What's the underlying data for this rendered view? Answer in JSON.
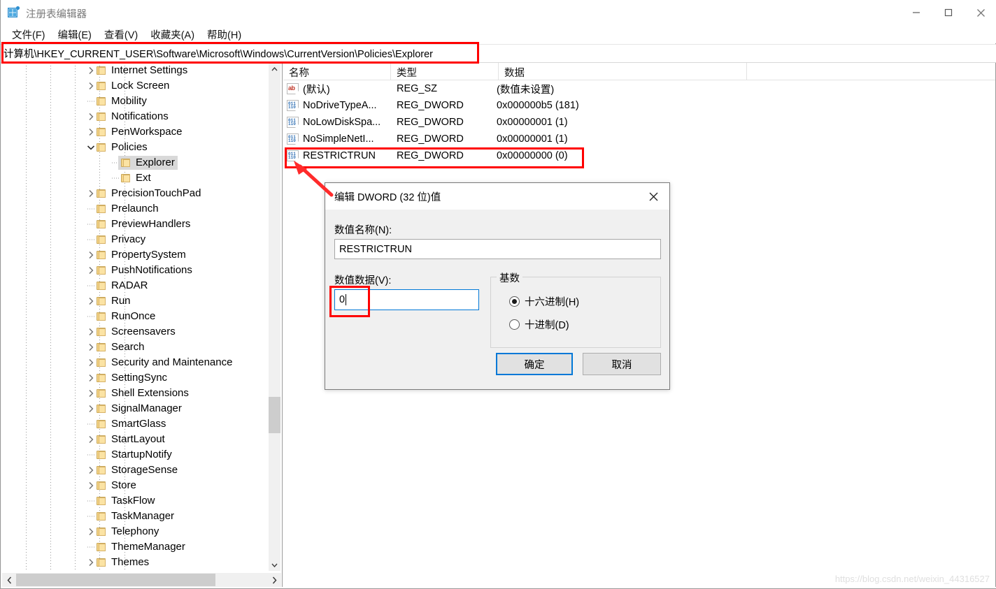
{
  "window": {
    "title": "注册表编辑器",
    "icon": "registry-editor-icon",
    "controls": {
      "minimize": "最小化",
      "maximize": "最大化",
      "close": "关闭"
    }
  },
  "menubar": {
    "items": [
      {
        "label": "文件(F)"
      },
      {
        "label": "编辑(E)"
      },
      {
        "label": "查看(V)"
      },
      {
        "label": "收藏夹(A)"
      },
      {
        "label": "帮助(H)"
      }
    ]
  },
  "address": {
    "path": "计算机\\HKEY_CURRENT_USER\\Software\\Microsoft\\Windows\\CurrentVersion\\Policies\\Explorer"
  },
  "tree": {
    "items": [
      {
        "label": "Internet Settings",
        "indent": 5,
        "twist": "collapsed",
        "selected": false
      },
      {
        "label": "Lock Screen",
        "indent": 5,
        "twist": "collapsed",
        "selected": false
      },
      {
        "label": "Mobility",
        "indent": 5,
        "twist": "none",
        "selected": false
      },
      {
        "label": "Notifications",
        "indent": 5,
        "twist": "collapsed",
        "selected": false
      },
      {
        "label": "PenWorkspace",
        "indent": 5,
        "twist": "collapsed",
        "selected": false
      },
      {
        "label": "Policies",
        "indent": 5,
        "twist": "expanded",
        "selected": false
      },
      {
        "label": "Explorer",
        "indent": 6,
        "twist": "none",
        "selected": true
      },
      {
        "label": "Ext",
        "indent": 6,
        "twist": "none",
        "selected": false
      },
      {
        "label": "PrecisionTouchPad",
        "indent": 5,
        "twist": "collapsed",
        "selected": false
      },
      {
        "label": "Prelaunch",
        "indent": 5,
        "twist": "none",
        "selected": false
      },
      {
        "label": "PreviewHandlers",
        "indent": 5,
        "twist": "none",
        "selected": false
      },
      {
        "label": "Privacy",
        "indent": 5,
        "twist": "none",
        "selected": false
      },
      {
        "label": "PropertySystem",
        "indent": 5,
        "twist": "collapsed",
        "selected": false
      },
      {
        "label": "PushNotifications",
        "indent": 5,
        "twist": "collapsed",
        "selected": false
      },
      {
        "label": "RADAR",
        "indent": 5,
        "twist": "none",
        "selected": false
      },
      {
        "label": "Run",
        "indent": 5,
        "twist": "collapsed",
        "selected": false
      },
      {
        "label": "RunOnce",
        "indent": 5,
        "twist": "none",
        "selected": false
      },
      {
        "label": "Screensavers",
        "indent": 5,
        "twist": "collapsed",
        "selected": false
      },
      {
        "label": "Search",
        "indent": 5,
        "twist": "collapsed",
        "selected": false
      },
      {
        "label": "Security and Maintenance",
        "indent": 5,
        "twist": "collapsed",
        "selected": false
      },
      {
        "label": "SettingSync",
        "indent": 5,
        "twist": "collapsed",
        "selected": false
      },
      {
        "label": "Shell Extensions",
        "indent": 5,
        "twist": "collapsed",
        "selected": false
      },
      {
        "label": "SignalManager",
        "indent": 5,
        "twist": "collapsed",
        "selected": false
      },
      {
        "label": "SmartGlass",
        "indent": 5,
        "twist": "none",
        "selected": false
      },
      {
        "label": "StartLayout",
        "indent": 5,
        "twist": "collapsed",
        "selected": false
      },
      {
        "label": "StartupNotify",
        "indent": 5,
        "twist": "none",
        "selected": false
      },
      {
        "label": "StorageSense",
        "indent": 5,
        "twist": "collapsed",
        "selected": false
      },
      {
        "label": "Store",
        "indent": 5,
        "twist": "collapsed",
        "selected": false
      },
      {
        "label": "TaskFlow",
        "indent": 5,
        "twist": "none",
        "selected": false
      },
      {
        "label": "TaskManager",
        "indent": 5,
        "twist": "none",
        "selected": false
      },
      {
        "label": "Telephony",
        "indent": 5,
        "twist": "collapsed",
        "selected": false
      },
      {
        "label": "ThemeManager",
        "indent": 5,
        "twist": "none",
        "selected": false
      },
      {
        "label": "Themes",
        "indent": 5,
        "twist": "collapsed",
        "selected": false
      }
    ]
  },
  "values": {
    "columns": [
      {
        "label": "名称"
      },
      {
        "label": "类型"
      },
      {
        "label": "数据"
      }
    ],
    "rows": [
      {
        "icon": "reg-string-icon",
        "name": "(默认)",
        "type": "REG_SZ",
        "data": "(数值未设置)",
        "highlighted": false
      },
      {
        "icon": "reg-dword-icon",
        "name": "NoDriveTypeA...",
        "type": "REG_DWORD",
        "data": "0x000000b5 (181)",
        "highlighted": false
      },
      {
        "icon": "reg-dword-icon",
        "name": "NoLowDiskSpa...",
        "type": "REG_DWORD",
        "data": "0x00000001 (1)",
        "highlighted": false
      },
      {
        "icon": "reg-dword-icon",
        "name": "NoSimpleNetI...",
        "type": "REG_DWORD",
        "data": "0x00000001 (1)",
        "highlighted": false
      },
      {
        "icon": "reg-dword-icon",
        "name": "RESTRICTRUN",
        "type": "REG_DWORD",
        "data": "0x00000000 (0)",
        "highlighted": true
      }
    ]
  },
  "dialog": {
    "title": "编辑 DWORD (32 位)值",
    "close_label": "×",
    "name_label": "数值名称(N):",
    "name_value": "RESTRICTRUN",
    "data_label": "数值数据(V):",
    "data_value": "0",
    "base_group_label": "基数",
    "radios": [
      {
        "label": "十六进制(H)",
        "checked": true
      },
      {
        "label": "十进制(D)",
        "checked": false
      }
    ],
    "ok_label": "确定",
    "cancel_label": "取消"
  },
  "annotations": {
    "address_highlight": "红框-地址栏",
    "restrictrun_highlight": "红框-RESTRICTRUN行",
    "data_input_highlight": "红框-数值数据框",
    "arrow": "红色箭头"
  },
  "watermark": {
    "text": "https://blog.csdn.net/weixin_44316527"
  },
  "colors": {
    "annotation_red": "#ff0000",
    "accent_blue": "#0078d7",
    "selection_gray": "#d9d9d9",
    "folder_yellow": "#f6d68a"
  }
}
